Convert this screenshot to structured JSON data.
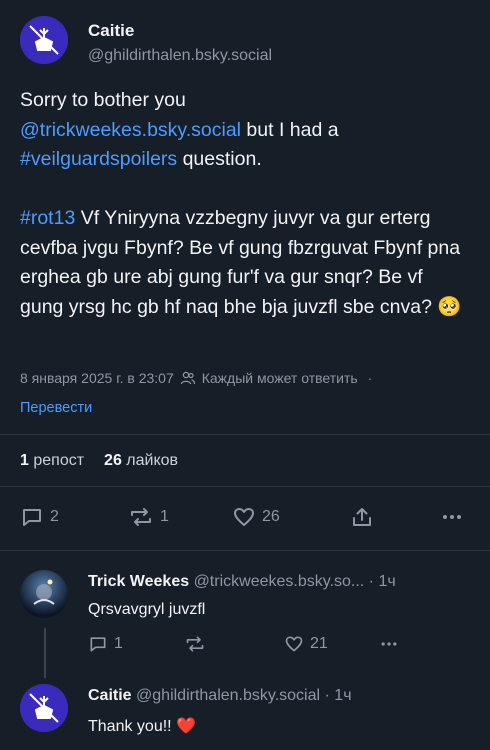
{
  "post": {
    "author_name": "Caitie",
    "author_handle": "@ghildirthalen.bsky.social",
    "text_part1": "Sorry to bother you",
    "mention": "@trickweekes.bsky.social",
    "text_part2": " but I had a",
    "hashtag1": "#veilguardspoilers",
    "text_part3": " question.",
    "hashtag2": "#rot13",
    "text_part4": " Vf Yniryyna vzzbegny juvyr va gur erterg cevfba jvgu Fbynf? Be vf gung fbzrguvat Fbynf pna erghea gb ure abj gung fur'f va gur snqr? Be vf gung yrsg hc gb hf naq bhe bja juvzfl sbe cnva? 🥺",
    "timestamp": "8 января 2025 г. в 23:07",
    "reply_setting": "Каждый может ответить",
    "translate": "Перевести",
    "reposts_count": "1",
    "reposts_label": "репост",
    "likes_count": "26",
    "likes_label": "лайков",
    "actions": {
      "replies": "2",
      "reposts": "1",
      "likes": "26"
    }
  },
  "replies": [
    {
      "author_name": "Trick Weekes",
      "author_handle": "@trickweekes.bsky.so...",
      "time": "· 1ч",
      "text": "Qrsvavgryl juvzfl",
      "actions": {
        "replies": "1",
        "reposts": "",
        "likes": "21"
      }
    },
    {
      "author_name": "Caitie",
      "author_handle": "@ghildirthalen.bsky.social",
      "time": "· 1ч",
      "text": "Thank you!!",
      "emoji": "❤️"
    }
  ],
  "colors": {
    "background": "#161e27",
    "link": "#4f9bff",
    "muted": "#8d98a5",
    "avatar_purple": "#3b2bbd"
  }
}
